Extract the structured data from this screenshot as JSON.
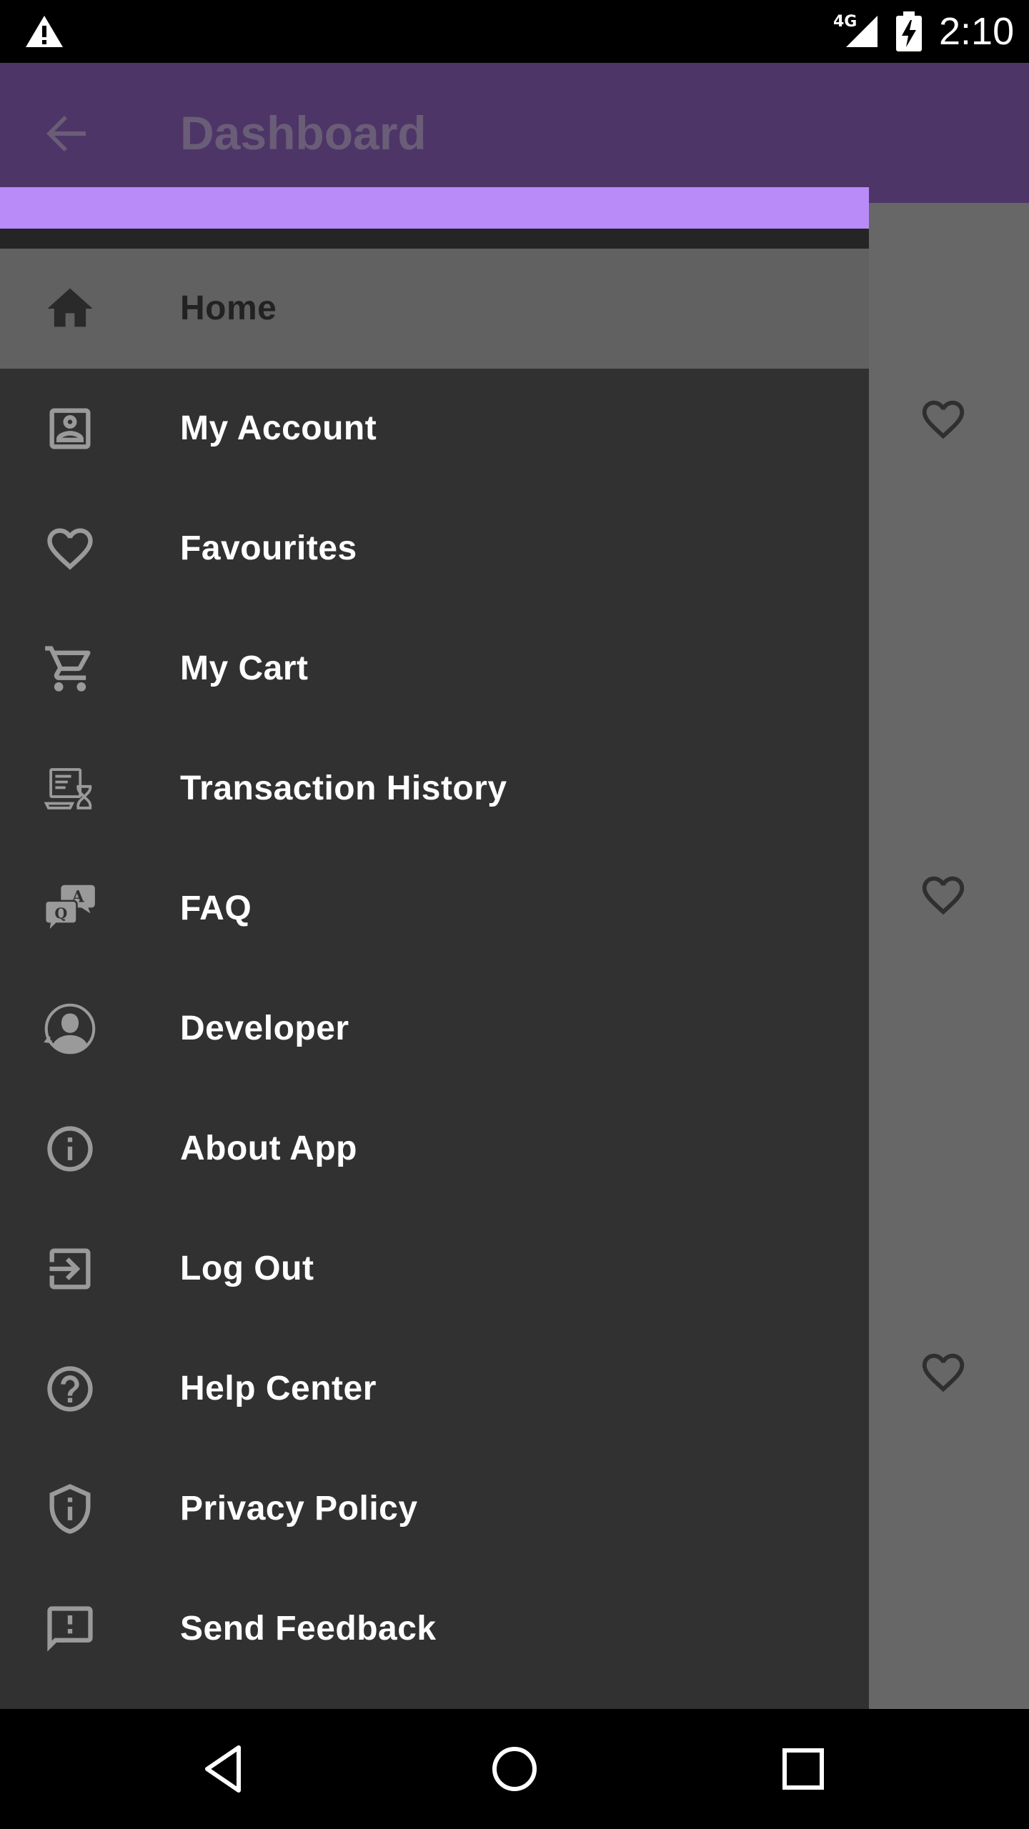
{
  "status_bar": {
    "network": "4G",
    "time": "2:10"
  },
  "app_bar": {
    "title": "Dashboard"
  },
  "drawer": {
    "accent_color": "#b98bf9",
    "items": [
      {
        "label": "Home",
        "icon": "home-icon",
        "active": true
      },
      {
        "label": "My Account",
        "icon": "account-box-icon"
      },
      {
        "label": "Favourites",
        "icon": "heart-outline-icon"
      },
      {
        "label": "My Cart",
        "icon": "cart-icon"
      },
      {
        "label": "Transaction History",
        "icon": "transaction-history-icon"
      },
      {
        "label": "FAQ",
        "icon": "faq-icon"
      },
      {
        "label": "Developer",
        "icon": "developer-icon"
      },
      {
        "label": "About App",
        "icon": "info-icon"
      },
      {
        "label": "Log Out",
        "icon": "logout-icon"
      },
      {
        "label": "Help Center",
        "icon": "help-icon"
      },
      {
        "label": "Privacy Policy",
        "icon": "shield-icon"
      },
      {
        "label": "Send Feedback",
        "icon": "feedback-icon"
      }
    ]
  },
  "colors": {
    "app_bar": "#4e3567",
    "drawer_bg": "#313131",
    "active_item": "#616161"
  }
}
